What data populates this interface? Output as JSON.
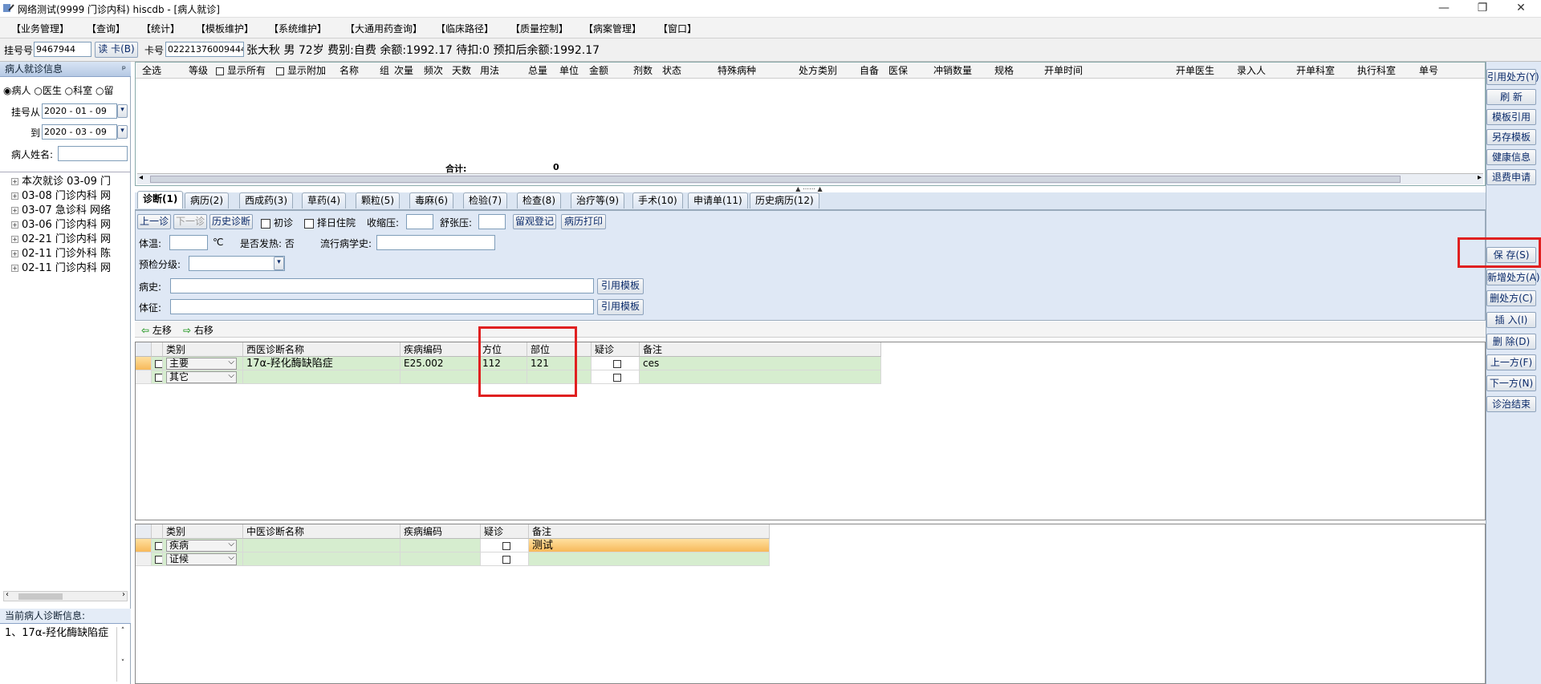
{
  "window": {
    "title": "网络测试(9999 门诊内科)  hiscdb - [病人就诊]"
  },
  "menu": [
    "【业务管理】",
    "【查询】",
    "【统计】",
    "【模板维护】",
    "【系统维护】",
    "【大通用药查询】",
    "【临床路径】",
    "【质量控制】",
    "【病案管理】",
    "【窗口】"
  ],
  "reg": {
    "reg_label": "挂号号",
    "reg_no": "9467944",
    "read_card": "读 卡(B)",
    "card_label": "卡号",
    "card_no": "02221376009444543",
    "patient_info": "张大秋  男  72岁  费别:自费  余额:1992.17  待扣:0  预扣后余额:1992.17"
  },
  "left": {
    "header": "病人就诊信息",
    "pin": "ᵖ",
    "radios": [
      "病人",
      "医生",
      "科室",
      "留"
    ],
    "reg_from_label": "挂号从",
    "reg_from": "2020 - 01 - 09",
    "to_label": "到",
    "to": "2020 - 03 - 09",
    "name_label": "病人姓名:",
    "tree": [
      "本次就诊  03-09  门",
      "03-08  门诊内科  网",
      "03-07  急诊科  网络",
      "03-06  门诊内科  网",
      "02-21  门诊内科  网",
      "02-11  门诊外科  陈",
      "02-11  门诊内科  网"
    ],
    "diag_header": "当前病人诊断信息:",
    "diag_text": "1、17α-羟化酶缺陷症"
  },
  "rx_grid": {
    "headers": [
      "全选",
      "等级",
      "显示所有",
      "显示附加",
      "名称",
      "组",
      "次量",
      "频次",
      "天数",
      "用法",
      "总量",
      "单位",
      "金额",
      "剂数",
      "状态",
      "特殊病种",
      "处方类别",
      "自备",
      "医保",
      "冲销数量",
      "规格",
      "开单时间",
      "开单医生",
      "录入人",
      "开单科室",
      "执行科室",
      "单号"
    ],
    "total_label": "合计:",
    "total_value": "0"
  },
  "tabs": [
    "诊断(1)",
    "病历(2)",
    "西成药(3)",
    "草药(4)",
    "颗粒(5)",
    "毒麻(6)",
    "检验(7)",
    "检查(8)",
    "治疗等(9)",
    "手术(10)",
    "申请单(11)",
    "历史病历(12)"
  ],
  "form": {
    "prev": "上一诊",
    "next": "下一诊",
    "history": "历史诊断",
    "first_visit": "初诊",
    "choose_day": "择日住院",
    "systolic": "收缩压:",
    "diastolic": "舒张压:",
    "observe": "留观登记",
    "print": "病历打印",
    "temp": "体温:",
    "temp_unit": "℃",
    "fever": "是否发热: 否",
    "epi": "流行病学史:",
    "triage": "预检分级:",
    "history_label": "病史:",
    "exam_label": "体征:",
    "quote1": "引用模板",
    "quote2": "引用模板"
  },
  "move": {
    "left": "左移",
    "right": "右移"
  },
  "west_grid": {
    "headers": [
      "类别",
      "西医诊断名称",
      "疾病编码",
      "方位",
      "部位",
      "疑诊",
      "备注"
    ],
    "rows": [
      {
        "type": "主要",
        "name": "17α-羟化酶缺陷症",
        "code": "E25.002",
        "pos": "112",
        "site": "121",
        "note": "ces"
      },
      {
        "type": "其它",
        "name": "",
        "code": "",
        "pos": "",
        "site": "",
        "note": ""
      }
    ]
  },
  "tcm_grid": {
    "headers": [
      "类别",
      "中医诊断名称",
      "疾病编码",
      "疑诊",
      "备注"
    ],
    "rows": [
      {
        "type": "疾病",
        "note": "测试"
      },
      {
        "type": "证候",
        "note": ""
      }
    ]
  },
  "right_buttons": [
    "引用处方(Y)",
    "刷  新",
    "模板引用",
    "另存模板",
    "健康信息",
    "退费申请",
    "保  存(S)",
    "新增处方(A)",
    "删处方(C)",
    "插  入(I)",
    "删  除(D)",
    "上一方(F)",
    "下一方(N)",
    "诊治结束"
  ],
  "colors": {
    "accent": "#e02020",
    "green_row": "#d6edcf",
    "form_bg": "#dfe8f5"
  }
}
